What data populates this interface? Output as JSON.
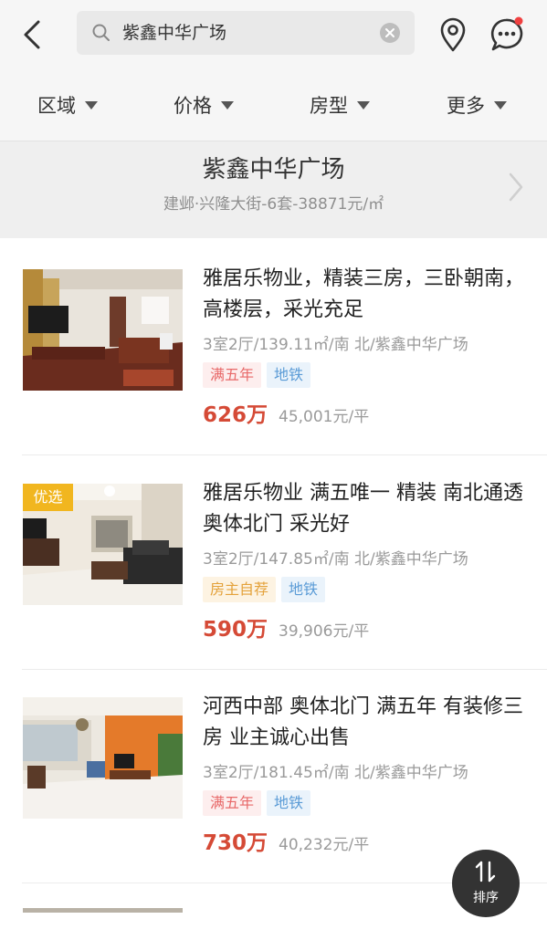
{
  "search": {
    "value": "紫鑫中华广场"
  },
  "filters": [
    {
      "label": "区域"
    },
    {
      "label": "价格"
    },
    {
      "label": "房型"
    },
    {
      "label": "更多"
    }
  ],
  "estate": {
    "name": "紫鑫中华广场",
    "summary": "建邺·兴隆大街-6套-38871元/㎡"
  },
  "listings": [
    {
      "title": "雅居乐物业，精装三房，三卧朝南，高楼层，采光充足",
      "meta": "3室2厅/139.11㎡/南 北/紫鑫中华广场",
      "tags": [
        "满五年",
        "地铁"
      ],
      "total": "626万",
      "unit_price": "45,001元/平"
    },
    {
      "badge": "优选",
      "title": "雅居乐物业 满五唯一 精装 南北通透 奥体北门 采光好",
      "meta": "3室2厅/147.85㎡/南 北/紫鑫中华广场",
      "tags": [
        "房主自荐",
        "地铁"
      ],
      "total": "590万",
      "unit_price": "39,906元/平"
    },
    {
      "title": "河西中部 奥体北门 满五年 有装修三房 业主诚心出售",
      "meta": "3室2厅/181.45㎡/南 北/紫鑫中华广场",
      "tags": [
        "满五年",
        "地铁"
      ],
      "total": "730万",
      "unit_price": "40,232元/平"
    }
  ],
  "sort_button": {
    "label": "排序"
  },
  "colors": {
    "price": "#d54a36",
    "badge": "#f1b61f",
    "notification_dot": "#f04040"
  }
}
